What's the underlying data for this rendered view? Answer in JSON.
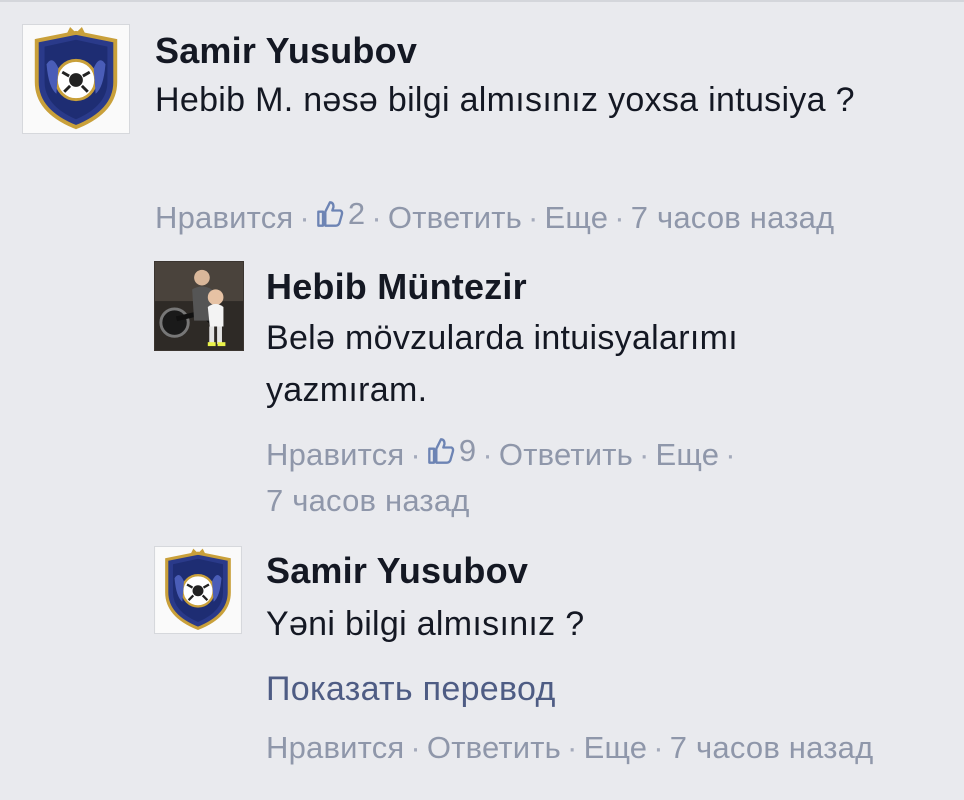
{
  "comments": [
    {
      "author": "Samir Yusubov",
      "text": "Hebib M. nəsə bilgi almısınız yoxsa intusiya ?",
      "actions": {
        "like": "Нравится",
        "like_count": "2",
        "reply": "Ответить",
        "more": "Еще",
        "time": "7 часов назад"
      }
    },
    {
      "author": "Hebib Müntezir",
      "text": "Belə mövzularda intuisyalarımı yazmıram.",
      "actions": {
        "like": "Нравится",
        "like_count": "9",
        "reply": "Ответить",
        "more": "Еще",
        "time": "7 часов назад"
      }
    },
    {
      "author": "Samir Yusubov",
      "text": "Yəni bilgi almısınız ?",
      "translate": "Показать перевод",
      "actions": {
        "like": "Нравится",
        "reply": "Ответить",
        "more": "Еще",
        "time": "7 часов назад"
      }
    }
  ]
}
